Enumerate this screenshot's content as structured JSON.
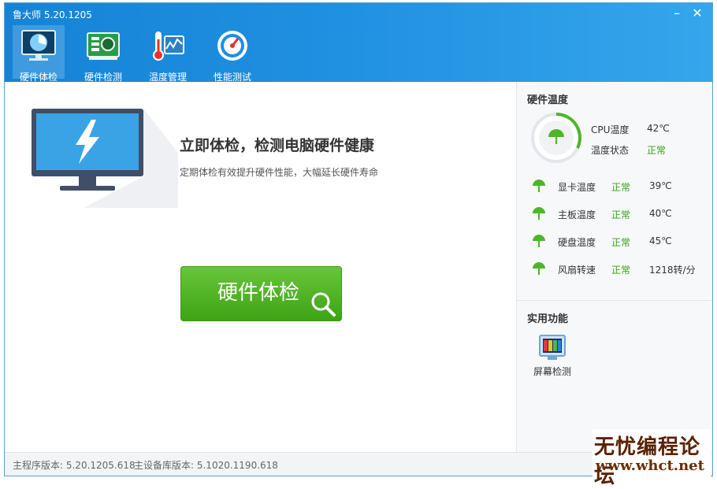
{
  "window": {
    "title": "鲁大师 5.20.1205",
    "min_icon": "minimize-icon",
    "close_icon": "close-icon"
  },
  "tabs": [
    {
      "label": "硬件体检",
      "icon": "monitor-checkup-icon",
      "active": true
    },
    {
      "label": "硬件检测",
      "icon": "circuit-board-icon",
      "active": false
    },
    {
      "label": "温度管理",
      "icon": "thermometer-icon",
      "active": false
    },
    {
      "label": "性能测试",
      "icon": "speedometer-icon",
      "active": false
    }
  ],
  "main": {
    "headline": "立即体检，检测电脑硬件健康",
    "subline": "定期体检有效提升硬件性能，大幅延长硬件寿命",
    "check_button": "硬件体检"
  },
  "temps": {
    "title": "硬件温度",
    "cpu_label": "CPU温度",
    "cpu_value": "42℃",
    "status_label": "温度状态",
    "status_value": "正常",
    "rows": [
      {
        "name": "显卡温度",
        "status": "正常",
        "value": "39℃"
      },
      {
        "name": "主板温度",
        "status": "正常",
        "value": "40℃"
      },
      {
        "name": "硬盘温度",
        "status": "正常",
        "value": "45℃"
      },
      {
        "name": "风扇转速",
        "status": "正常",
        "value": "1218转/分"
      }
    ]
  },
  "tools": {
    "title": "实用功能",
    "items": [
      {
        "label": "屏幕检测",
        "icon": "screen-test-icon"
      }
    ]
  },
  "footer": {
    "main_version": "主程序版本: 5.20.1205.618",
    "db_version": "主设备库版本: 5.1020.1190.618"
  },
  "watermark": {
    "line1": "无忧编程论坛",
    "line2": "www.whct.net"
  },
  "colors": {
    "header": "#1f8fe0",
    "accent_green": "#3aa01a",
    "button_green": "#4fb126"
  }
}
